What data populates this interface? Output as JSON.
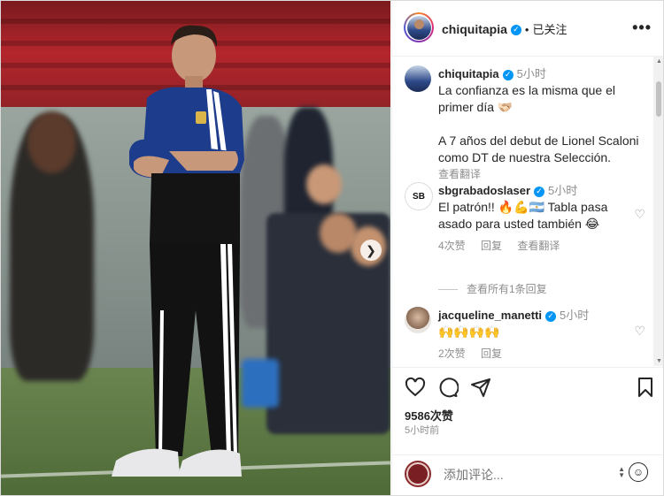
{
  "header": {
    "username": "chiquitapia",
    "separator": "•",
    "follow_status": "已关注",
    "more": "•••"
  },
  "photo": {
    "next": "❯"
  },
  "comments": [
    {
      "username": "chiquitapia",
      "time": "5小时",
      "text": "La confianza es la misma que el primer día 🫱🏻‍🫲🏼",
      "text2": "A 7 años del debut de Lionel Scaloni como DT de nuestra Selección.",
      "translate": "查看翻译"
    },
    {
      "username": "sbgrabadoslaser",
      "time": "5小时",
      "text": "El patrón!! 🔥💪🇦🇷 Tabla pasa asado para usted también 😂",
      "likes": "4次赞",
      "reply": "回复",
      "translate": "查看翻译",
      "view_replies": "查看所有1条回复"
    },
    {
      "username": "jacqueline_manetti",
      "time": "5小时",
      "text": "🙌🙌🙌🙌",
      "likes": "2次赞",
      "reply": "回复"
    }
  ],
  "actions": {
    "likes": "9586次赞",
    "post_time": "5小时前"
  },
  "composer": {
    "placeholder": "添加评论..."
  },
  "colors": {
    "verified": "#0095f6",
    "text": "#262626",
    "muted": "#8e8e8e"
  }
}
